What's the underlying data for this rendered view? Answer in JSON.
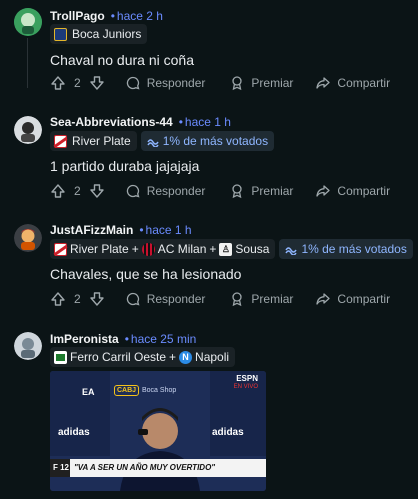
{
  "comments": [
    {
      "username": "TrollPago",
      "time": "hace 2 h",
      "flairs": [
        "Boca Juniors"
      ],
      "badge": "",
      "text": "Chaval no dura ni coña",
      "votes": "2",
      "reply": "Responder",
      "award": "Premiar",
      "share": "Compartir"
    },
    {
      "username": "Sea-Abbreviations-44",
      "time": "hace 1 h",
      "flairs": [
        "River Plate"
      ],
      "badge": "1% de más votados",
      "text": "1 partido duraba jajajaja",
      "votes": "2",
      "reply": "Responder",
      "award": "Premiar",
      "share": "Compartir"
    },
    {
      "username": "JustAFizzMain",
      "time": "hace 1 h",
      "flairs": [
        "River Plate",
        "AC Milan",
        "Sousa"
      ],
      "badge": "1% de más votados",
      "text": "Chavales, que se ha lesionado",
      "votes": "2",
      "reply": "Responder",
      "award": "Premiar",
      "share": "Compartir"
    },
    {
      "username": "ImPeronista",
      "time": "hace 25 min",
      "flairs": [
        "Ferro Carril Oeste",
        "Napoli"
      ],
      "media": {
        "caption": "\"VA A SER UN AÑO MUY OVERTIDO\"",
        "channel": "ESPN",
        "sponsor": "adidas",
        "shop": "Boca Shop",
        "crest": "CABJ",
        "ea": "EA",
        "live": "EN VIVO",
        "tag": "F 12"
      }
    }
  ],
  "plus": "+",
  "colors": {
    "accent": "#6b8cff",
    "bg": "#0b1416"
  }
}
